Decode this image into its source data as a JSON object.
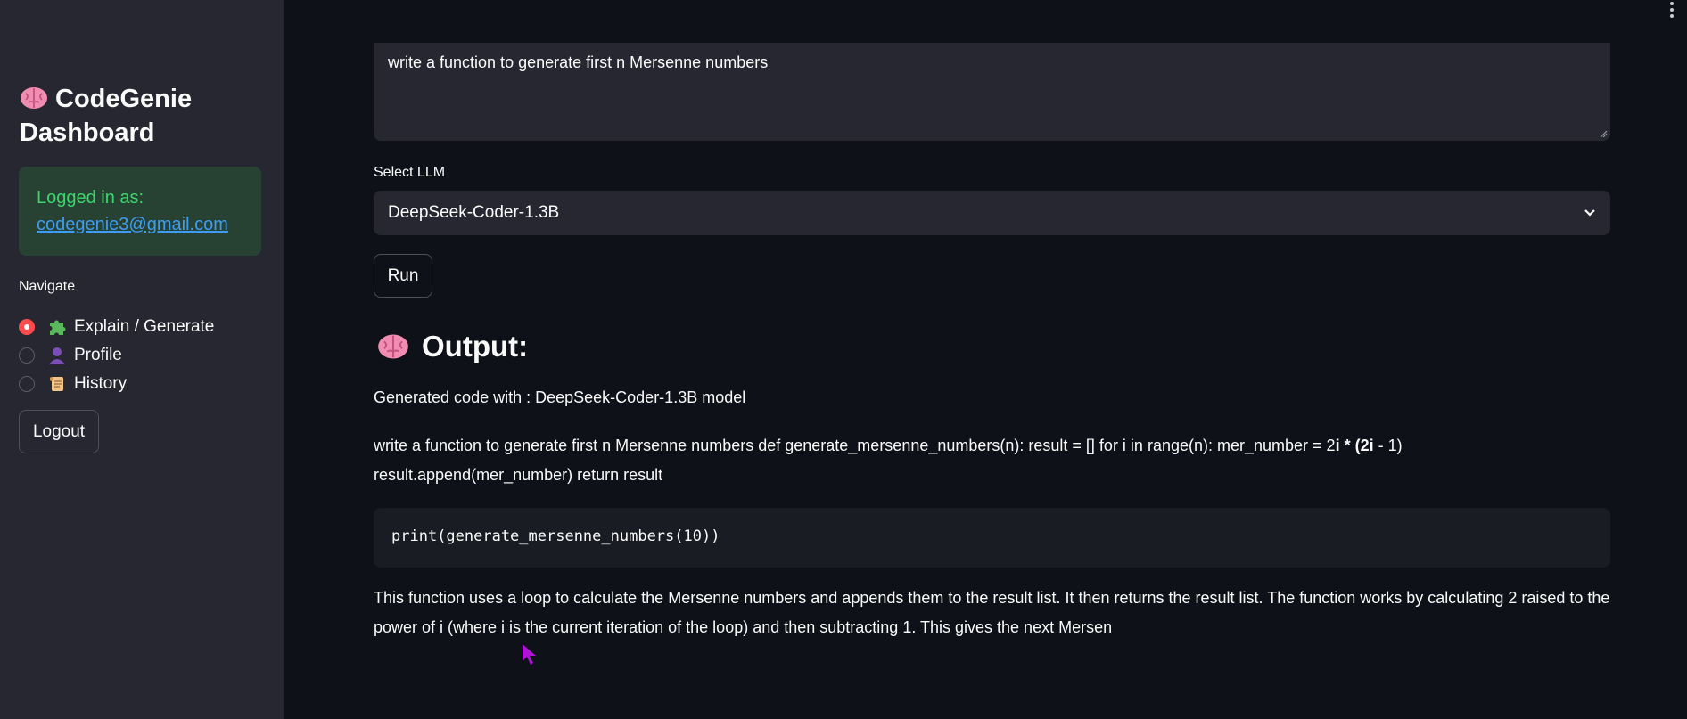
{
  "sidebar": {
    "title_line1": "CodeGenie",
    "title_line2": "Dashboard",
    "logged_in_label": "Logged in as:",
    "user_email": "codegenie3@gmail.com",
    "nav_label": "Navigate",
    "nav_items": [
      {
        "label": "Explain / Generate",
        "icon": "puzzle-icon",
        "selected": true
      },
      {
        "label": "Profile",
        "icon": "user-silhouette-icon",
        "selected": false
      },
      {
        "label": "History",
        "icon": "scroll-icon",
        "selected": false
      }
    ],
    "logout_label": "Logout"
  },
  "main": {
    "prompt_value": "write a function to generate first n Mersenne numbers",
    "select_label": "Select LLM",
    "selected_model": "DeepSeek-Coder-1.3B",
    "run_label": "Run",
    "output_heading": "Output:",
    "generated_with": "Generated code with : DeepSeek-Coder-1.3B model",
    "response_line1_prefix": "write a function to generate first n Mersenne numbers def generate_mersenne_numbers(n): result = [] for i in range(n): mer_number = 2",
    "response_line1_bold1": "i * (2",
    "response_line1_bold2": "i",
    "response_line1_suffix": " - 1)",
    "response_line2": "result.append(mer_number) return result",
    "code_line": "print(generate_mersenne_numbers(10))",
    "explanation": "This function uses a loop to calculate the Mersenne numbers and appends them to the result list. It then returns the result list. The function works by calculating 2 raised to the power of i (where i is the current iteration of the loop) and then subtracting 1. This gives the next Mersen"
  },
  "colors": {
    "sidebar_bg": "#262730",
    "main_bg": "#0e1117",
    "success_bg": "#274233",
    "success_text": "#3dd56d",
    "link": "#3d9df3",
    "radio_accent": "#ff4b4b"
  }
}
